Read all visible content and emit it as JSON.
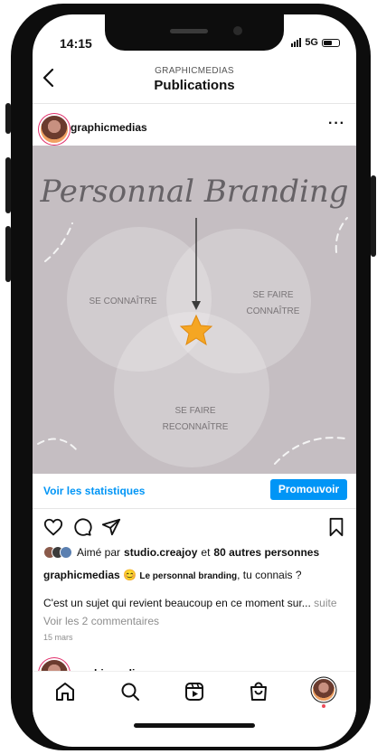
{
  "status": {
    "time": "14:15",
    "network": "5G"
  },
  "header": {
    "subtitle": "GRAPHICMEDIAS",
    "title": "Publications",
    "back_icon": "back-arrow-icon"
  },
  "post": {
    "username": "graphicmedias",
    "more_icon": "more-dots-icon",
    "image": {
      "title": "Personnal Branding",
      "circles": [
        "SE CONNAÎTRE",
        "SE FAIRE CONNAÎTRE",
        "SE FAIRE RECONNAÎTRE"
      ],
      "circle_label_lines": {
        "left": [
          "SE CONNAÎTRE"
        ],
        "right": [
          "SE FAIRE",
          "CONNAÎTRE"
        ],
        "bottom": [
          "SE FAIRE",
          "RECONNAÎTRE"
        ]
      },
      "colors": {
        "background": "#c5bec2",
        "star": "#f5a623",
        "text": "#6e6a6c"
      }
    },
    "stats_link": "Voir les statistiques",
    "promote_button": "Promouvoir",
    "likes": {
      "prefix": "Aimé par",
      "by": "studio.creajoy",
      "and": "et",
      "others": "80 autres personnes"
    },
    "caption": {
      "user": "graphicmedias",
      "emoji": "😊",
      "bold": "Le personnal branding",
      "rest": ", tu connais ?"
    },
    "caption_line2": {
      "text": "C'est un sujet qui revient beaucoup en ce moment sur...",
      "more": "suite"
    },
    "comments_link": "Voir les 2 commentaires",
    "date": "15 mars"
  },
  "next_post": {
    "username": "graphicmedias"
  },
  "nav": {
    "items": [
      "home-icon",
      "search-icon",
      "reels-icon",
      "shop-icon",
      "profile-icon"
    ]
  },
  "colors": {
    "accent": "#0095f6",
    "notification": "#ed4956"
  }
}
